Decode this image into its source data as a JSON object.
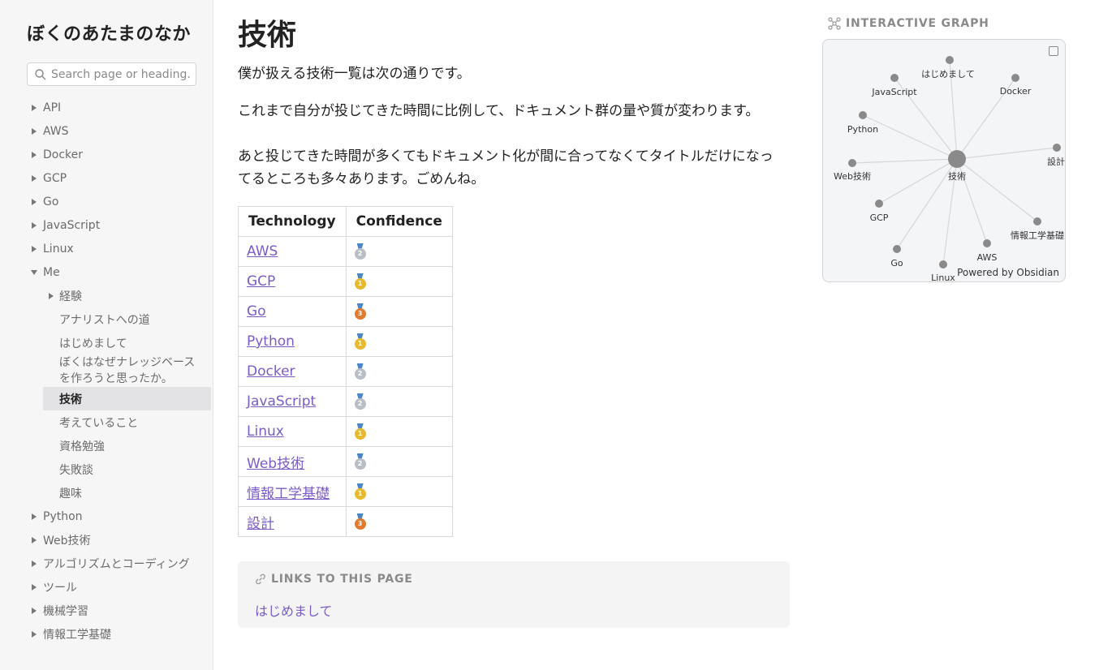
{
  "site": {
    "title": "ぼくのあたまのなか"
  },
  "search": {
    "placeholder": "Search page or heading..."
  },
  "sidebar": {
    "items": [
      {
        "label": "API"
      },
      {
        "label": "AWS"
      },
      {
        "label": "Docker"
      },
      {
        "label": "GCP"
      },
      {
        "label": "Go"
      },
      {
        "label": "JavaScript"
      },
      {
        "label": "Linux"
      },
      {
        "label": "Me"
      }
    ],
    "me_children": [
      {
        "label": "経験"
      },
      {
        "label": "アナリストへの道"
      },
      {
        "label": "はじめまして"
      },
      {
        "label": "ぼくはなぜナレッジベースを作ろうと思ったか。"
      },
      {
        "label": "技術"
      },
      {
        "label": "考えていること"
      },
      {
        "label": "資格勉強"
      },
      {
        "label": "失敗談"
      },
      {
        "label": "趣味"
      }
    ],
    "after_items": [
      {
        "label": "Python"
      },
      {
        "label": "Web技術"
      },
      {
        "label": "アルゴリズムとコーディング"
      },
      {
        "label": "ツール"
      },
      {
        "label": "機械学習"
      },
      {
        "label": "情報工学基礎"
      }
    ]
  },
  "page": {
    "title": "技術",
    "para1": "僕が扱える技術一覧は次の通りです。",
    "para2": "これまで自分が投じてきた時間に比例して、ドキュメント群の量や質が変わります。",
    "para3": "あと投じてきた時間が多くてもドキュメント化が間に合ってなくてタイトルだけになってるところも多々あります。ごめんね。"
  },
  "table": {
    "headers": [
      "Technology",
      "Confidence"
    ],
    "rows": [
      {
        "name": "AWS",
        "medal": "2"
      },
      {
        "name": "GCP",
        "medal": "1"
      },
      {
        "name": "Go",
        "medal": "3"
      },
      {
        "name": "Python",
        "medal": "1"
      },
      {
        "name": "Docker",
        "medal": "2"
      },
      {
        "name": "JavaScript",
        "medal": "2"
      },
      {
        "name": "Linux",
        "medal": "1"
      },
      {
        "name": "Web技術",
        "medal": "2"
      },
      {
        "name": "情報工学基礎",
        "medal": "1"
      },
      {
        "name": "設計",
        "medal": "3"
      }
    ]
  },
  "backlinks": {
    "header": "LINKS TO THIS PAGE",
    "links": [
      "はじめまして"
    ]
  },
  "graph": {
    "header": "INTERACTIVE GRAPH",
    "powered": "Powered by Obsidian",
    "center": "技術",
    "nodes": [
      "はじめまして",
      "JavaScript",
      "Docker",
      "Python",
      "設計",
      "Web技術",
      "GCP",
      "情報工学基礎",
      "Go",
      "AWS",
      "Linux"
    ]
  },
  "colors": {
    "link": "#7a5cc7",
    "gold": "#e8b92e",
    "silver": "#b9bec5",
    "bronze": "#e07a2e"
  }
}
